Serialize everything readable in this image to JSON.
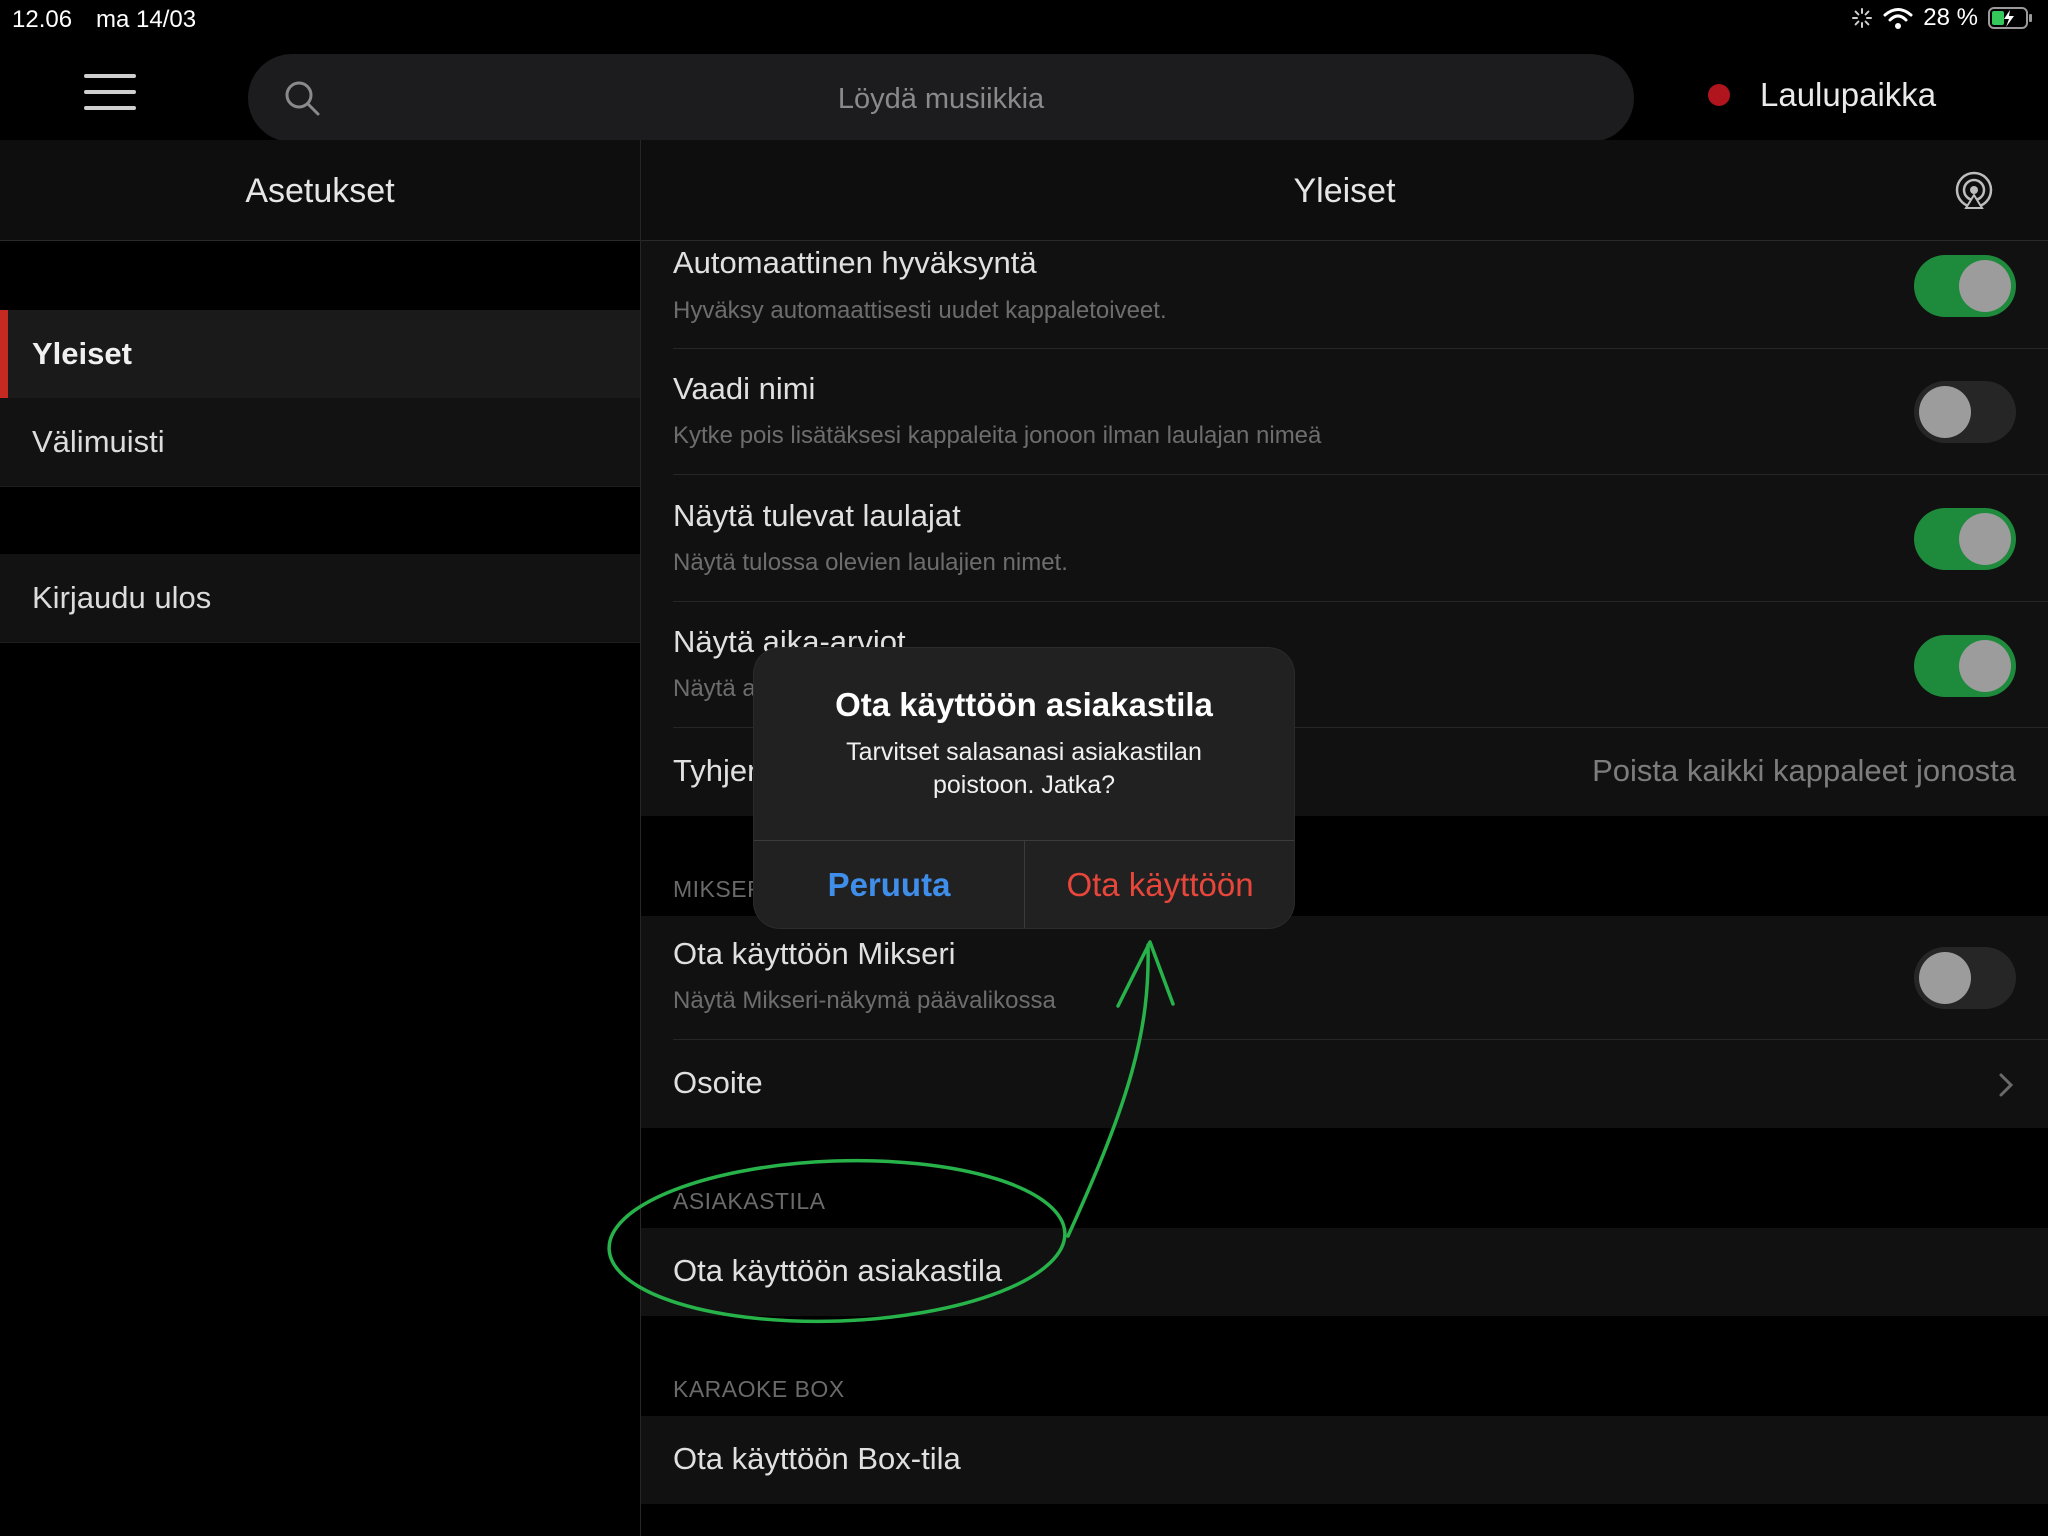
{
  "status_bar": {
    "time": "12.06",
    "date": "ma 14/03",
    "battery": "28 %"
  },
  "topbar": {
    "search_placeholder": "Löydä musiikkia",
    "venue": "Laulupaikka"
  },
  "sidebar": {
    "title": "Asetukset",
    "items": [
      {
        "label": "Yleiset",
        "active": true
      },
      {
        "label": "Välimuisti"
      }
    ],
    "logout": "Kirjaudu ulos"
  },
  "main": {
    "title": "Yleiset",
    "rows": [
      {
        "title": "Automaattinen hyväksyntä",
        "subtitle": "Hyväksy automaattisesti uudet kappaletoiveet.",
        "toggle": true
      },
      {
        "title": "Vaadi nimi",
        "subtitle": "Kytke pois lisätäksesi kappaleita jonoon ilman laulajan nimeä",
        "toggle": false
      },
      {
        "title": "Näytä tulevat laulajat",
        "subtitle": "Näytä tulossa olevien laulajien nimet.",
        "toggle": true
      },
      {
        "title": "Näytä aika-arviot",
        "subtitle": "Näytä a",
        "toggle": true
      },
      {
        "title": "Tyhjen",
        "value": "Poista kaikki kappaleet jonosta"
      }
    ],
    "section_mixer": "MIKSERI",
    "mixer_rows": [
      {
        "title": "Ota käyttöön Mikseri",
        "subtitle": "Näytä Mikseri-näkymä päävalikossa",
        "toggle": false
      },
      {
        "title": "Osoite"
      }
    ],
    "section_customer": "ASIAKASTILA",
    "customer_row": "Ota käyttöön asiakastila",
    "section_box": "KARAOKE BOX",
    "box_row": "Ota käyttöön Box-tila"
  },
  "dialog": {
    "title": "Ota käyttöön asiakastila",
    "message": "Tarvitset salasanasi asiakastilan poistoon. Jatka?",
    "cancel": "Peruuta",
    "confirm": "Ota käyttöön"
  },
  "colors": {
    "accent_red": "#c42a22",
    "toggle_on": "#1e8a3c",
    "dialog_cancel": "#3f8eea",
    "dialog_confirm": "#e8463a",
    "annotation": "#27b24a"
  }
}
